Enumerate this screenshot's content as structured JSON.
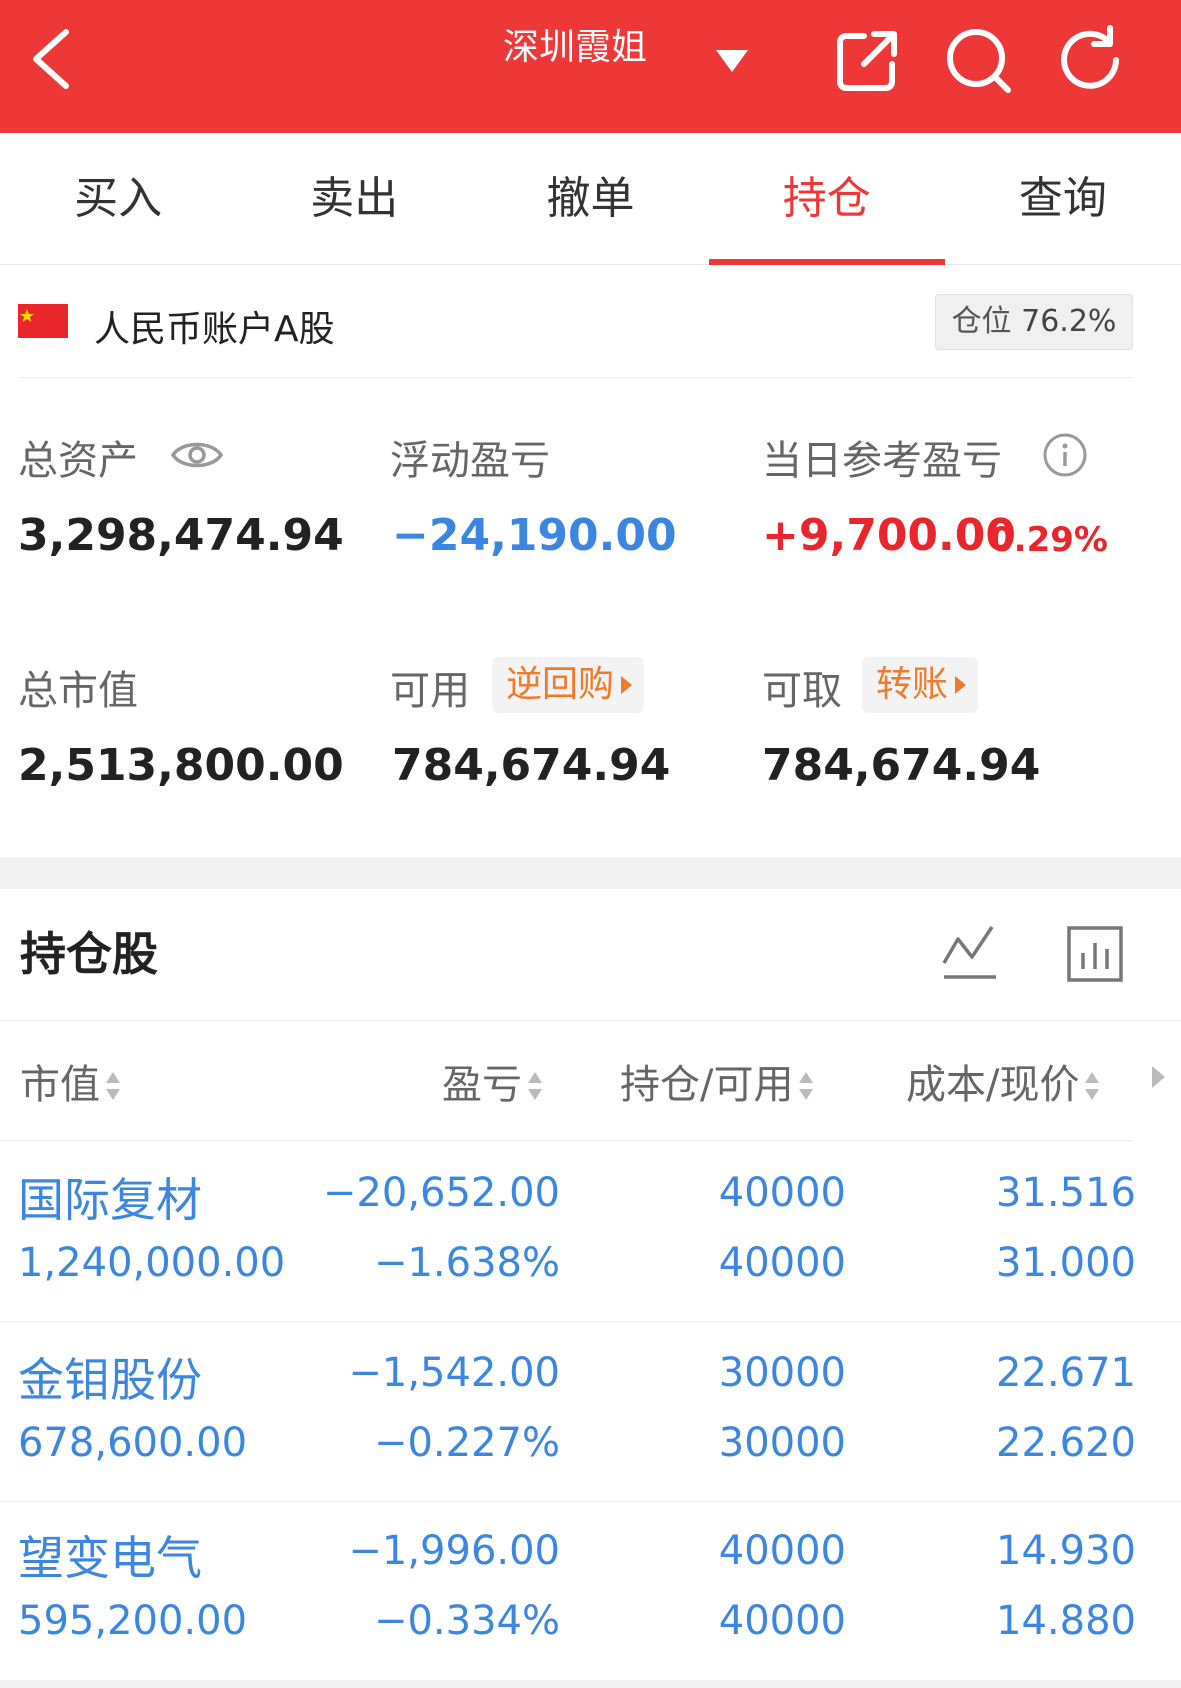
{
  "header": {
    "title": "深圳霞姐",
    "accent_color": "#ee3838",
    "icons": [
      "back-icon",
      "dropdown-caret-icon",
      "share-icon",
      "search-icon",
      "refresh-icon"
    ]
  },
  "tabs": [
    {
      "label": "买入",
      "active": false
    },
    {
      "label": "卖出",
      "active": false
    },
    {
      "label": "撤单",
      "active": false
    },
    {
      "label": "持仓",
      "active": true
    },
    {
      "label": "查询",
      "active": false
    }
  ],
  "account": {
    "label": "人民币账户A股",
    "position_label": "仓位",
    "position_value": "76.2%"
  },
  "stats": {
    "total_assets_label": "总资产",
    "total_assets": "3,298,474.94",
    "floating_pnl_label": "浮动盈亏",
    "floating_pnl": "−24,190.00",
    "daily_pnl_label": "当日参考盈亏",
    "daily_pnl": "+9,700.00",
    "daily_pnl_pct": "0.29%",
    "market_value_label": "总市值",
    "market_value": "2,513,800.00",
    "available_label": "可用",
    "available": "784,674.94",
    "repo_button": "逆回购",
    "withdrawable_label": "可取",
    "withdrawable": "784,674.94",
    "transfer_button": "转账"
  },
  "holdings": {
    "title": "持仓股",
    "columns": [
      "市值",
      "盈亏",
      "持仓/可用",
      "成本/现价"
    ],
    "rows": [
      {
        "name": "国际复材",
        "market_value": "1,240,000.00",
        "pnl": "−20,652.00",
        "pnl_pct": "−1.638%",
        "position": "40000",
        "available": "40000",
        "cost": "31.516",
        "price": "31.000"
      },
      {
        "name": "金钼股份",
        "market_value": "678,600.00",
        "pnl": "−1,542.00",
        "pnl_pct": "−0.227%",
        "position": "30000",
        "available": "30000",
        "cost": "22.671",
        "price": "22.620"
      },
      {
        "name": "望变电气",
        "market_value": "595,200.00",
        "pnl": "−1,996.00",
        "pnl_pct": "−0.334%",
        "position": "40000",
        "available": "40000",
        "cost": "14.930",
        "price": "14.880"
      }
    ]
  }
}
